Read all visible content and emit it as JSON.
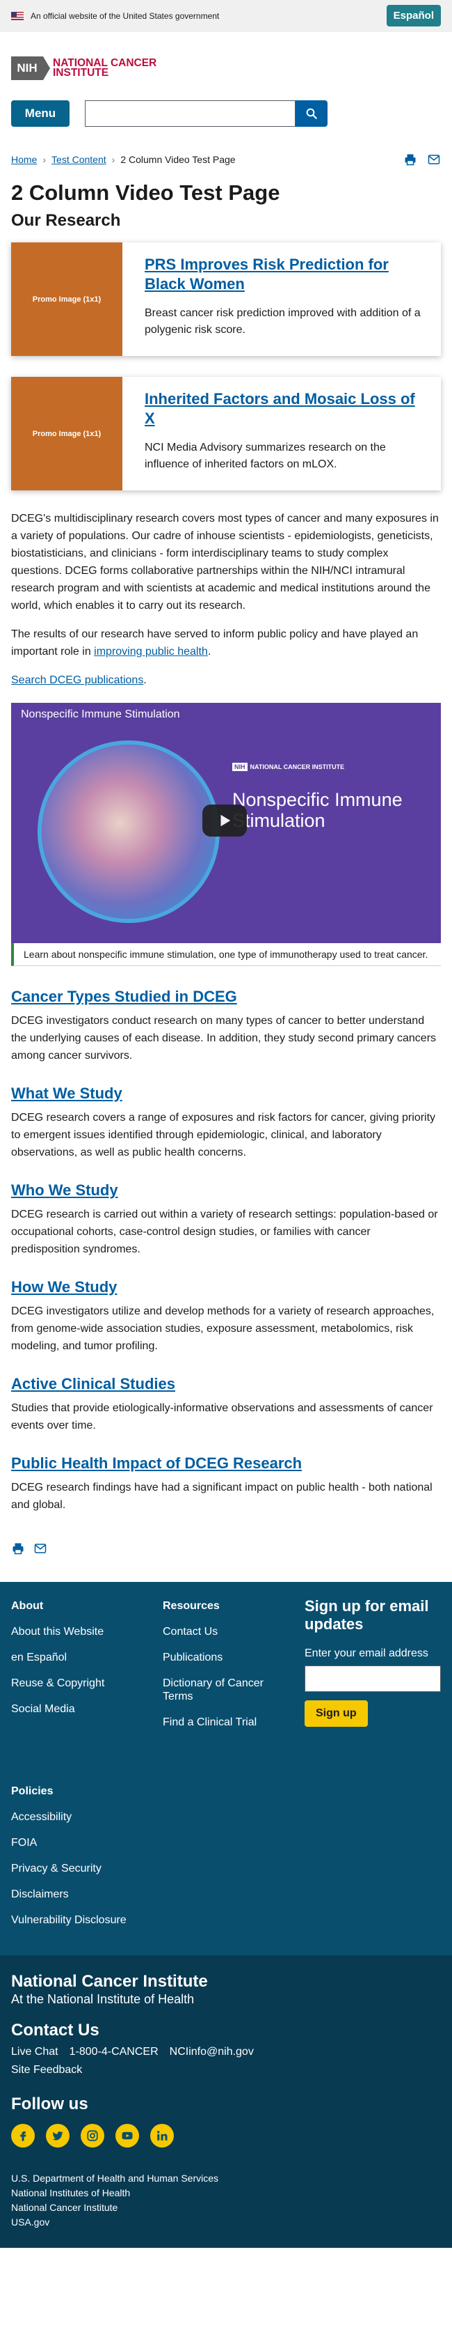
{
  "gov_banner": {
    "text": "An official website of the United States government",
    "espanol": "Español"
  },
  "header": {
    "logo_abbr": "NIH",
    "logo_line1": "National Cancer",
    "logo_line2": "Institute",
    "menu_label": "Menu",
    "search_placeholder": ""
  },
  "breadcrumb": {
    "home": "Home",
    "test_content": "Test Content",
    "current": "2 Column Video Test Page"
  },
  "page": {
    "title": "2 Column Video Test Page",
    "section_title": "Our Research"
  },
  "cards": [
    {
      "image_label": "Promo Image (1x1)",
      "title": "PRS Improves Risk Prediction for Black Women",
      "desc": "Breast cancer risk prediction improved with addition of a polygenic risk score."
    },
    {
      "image_label": "Promo Image (1x1)",
      "title": "Inherited Factors and Mosaic Loss of X",
      "desc": "NCI Media Advisory summarizes research on the influence of inherited factors on mLOX."
    }
  ],
  "intro": {
    "p1": "DCEG's multidisciplinary research covers most types of cancer and many exposures in a variety of populations. Our cadre of inhouse scientists - epidemiologists, geneticists, biostatisticians, and clinicians - form interdisciplinary teams to study complex questions. DCEG forms collaborative partnerships within the NIH/NCI intramural research program and with scientists at academic and medical institutions around the world, which enables it to carry out its research.",
    "p2_prefix": "The results of our research have served to inform public policy and have played an important role in ",
    "p2_link": "improving public health",
    "p2_suffix": ".",
    "search_link": "Search DCEG publications",
    "search_suffix": "."
  },
  "video": {
    "title": "Nonspecific Immune Stimulation",
    "brand": "NATIONAL CANCER INSTITUTE",
    "heading_line1": "Nonspecific Immune",
    "heading_line2": "Stimulation",
    "caption": "Learn about nonspecific immune stimulation, one type of immunotherapy used to treat cancer."
  },
  "features": [
    {
      "title": "Cancer Types Studied in DCEG",
      "desc": "DCEG investigators conduct research on many types of cancer to better understand the underlying causes of each disease. In addition, they study second primary cancers among cancer survivors."
    },
    {
      "title": "What We Study",
      "desc": "DCEG research covers a range of exposures and risk factors for cancer, giving priority to emergent issues identified through epidemiologic, clinical, and laboratory observations, as well as public health concerns."
    },
    {
      "title": "Who We Study",
      "desc": "DCEG research is carried out within a variety of research settings: population-based or occupational cohorts, case-control design studies, or families with cancer predisposition syndromes."
    },
    {
      "title": "How We Study",
      "desc": "DCEG investigators utilize and develop methods for a variety of research approaches, from genome-wide association studies, exposure assessment, metabolomics, risk modeling, and tumor profiling."
    },
    {
      "title": "Active Clinical Studies",
      "desc": "Studies that provide etiologically-informative observations and assessments of cancer events over time."
    },
    {
      "title": "Public Health Impact of DCEG Research",
      "desc": "DCEG research findings have had a significant impact on public health - both national and global."
    }
  ],
  "footer": {
    "about": {
      "title": "About",
      "links": [
        "About this Website",
        "en Español",
        "Reuse & Copyright",
        "Social Media"
      ]
    },
    "resources": {
      "title": "Resources",
      "links": [
        "Contact Us",
        "Publications",
        "Dictionary of Cancer Terms",
        "Find a Clinical Trial"
      ]
    },
    "policies": {
      "title": "Policies",
      "links": [
        "Accessibility",
        "FOIA",
        "Privacy & Security",
        "Disclaimers",
        "Vulnerability Disclosure"
      ]
    },
    "signup": {
      "title": "Sign up for email updates",
      "label": "Enter your email address",
      "button": "Sign up"
    },
    "org": "National Cancer Institute",
    "org_sub": "At the National Institute of Health",
    "contact_title": "Contact Us",
    "contact_links": [
      "Live Chat",
      "1-800-4-CANCER",
      "NCIinfo@nih.gov"
    ],
    "site_feedback": "Site Feedback",
    "follow_title": "Follow us",
    "gov_links": [
      "U.S. Department of Health and Human Services",
      "National Institutes of Health",
      "National Cancer Institute",
      "USA.gov"
    ]
  },
  "colors": {
    "link": "#005ea2",
    "primary_button": "#07648d",
    "espanol_button": "#207f8a",
    "promo": "#c46b27",
    "footer": "#0a4e6e",
    "footer_bottom": "#083a52",
    "accent_yellow": "#f5c800",
    "logo_red": "#bb0e3d"
  },
  "icons": {
    "print": "print-icon",
    "email": "email-icon",
    "search": "search-icon",
    "play": "play-icon",
    "social": [
      "facebook-icon",
      "twitter-icon",
      "instagram-icon",
      "youtube-icon",
      "linkedin-icon"
    ]
  }
}
